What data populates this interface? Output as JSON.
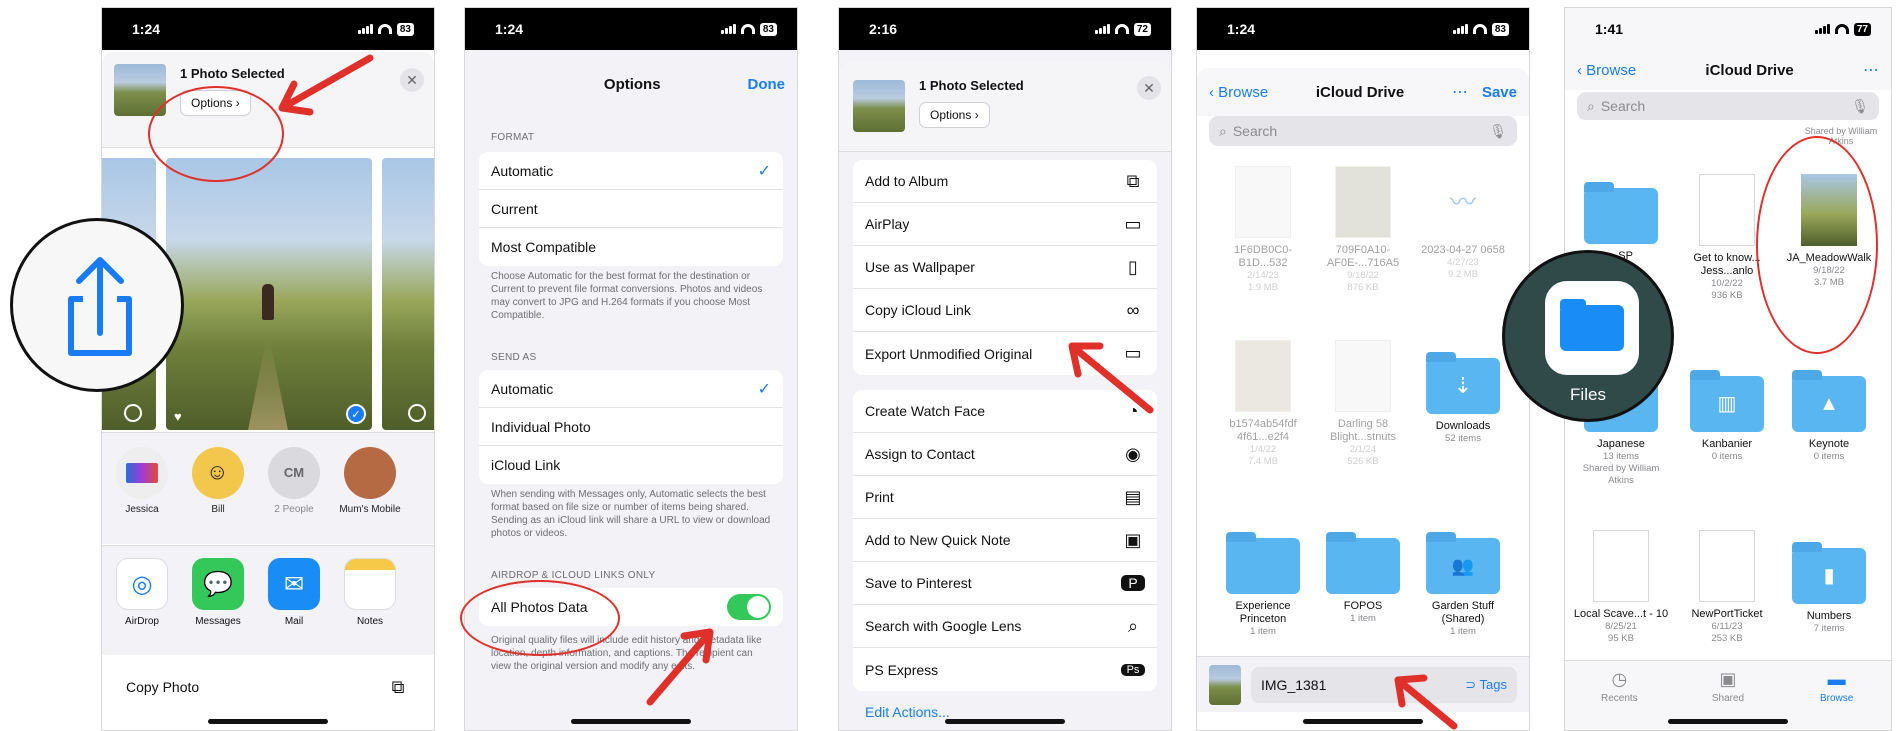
{
  "screens": [
    {
      "time": "1:24",
      "battery": "83",
      "selected_title": "1 Photo Selected",
      "options_label": "Options",
      "contacts": [
        "Jessica",
        "Bill",
        "2 People",
        "Mum's Mobile"
      ],
      "contact_initials": "CM",
      "apps": [
        "AirDrop",
        "Messages",
        "Mail",
        "Notes"
      ],
      "action": "Copy Photo"
    },
    {
      "time": "1:24",
      "battery": "83",
      "title": "Options",
      "done": "Done",
      "format_header": "FORMAT",
      "format_options": [
        "Automatic",
        "Current",
        "Most Compatible"
      ],
      "format_note": "Choose Automatic for the best format for the destination or Current to prevent file format conversions. Photos and videos may convert to JPG and H.264 formats if you choose Most Compatible.",
      "sendas_header": "SEND AS",
      "sendas_options": [
        "Automatic",
        "Individual Photo",
        "iCloud Link"
      ],
      "sendas_note": "When sending with Messages only, Automatic selects the best format based on file size or number of items being shared. Sending as an iCloud link will share a URL to view or download photos or videos.",
      "airdrop_header": "AIRDROP & ICLOUD LINKS ONLY",
      "all_photos_data": "All Photos Data",
      "all_photos_note": "Original quality files will include edit history and metadata like location, depth information, and captions. The recipient can view the original version and modify any edits."
    },
    {
      "time": "2:16",
      "battery": "72",
      "selected_title": "1 Photo Selected",
      "options_label": "Options",
      "group1": [
        {
          "label": "Add to Album",
          "icon": "album-icon"
        },
        {
          "label": "AirPlay",
          "icon": "airplay-icon"
        },
        {
          "label": "Use as Wallpaper",
          "icon": "phone-icon"
        },
        {
          "label": "Copy iCloud Link",
          "icon": "link-icon"
        },
        {
          "label": "Export Unmodified Original",
          "icon": "folder-icon"
        }
      ],
      "group2": [
        {
          "label": "Create Watch Face",
          "icon": "watch-icon"
        },
        {
          "label": "Assign to Contact",
          "icon": "contact-icon"
        },
        {
          "label": "Print",
          "icon": "printer-icon"
        },
        {
          "label": "Add to New Quick Note",
          "icon": "note-icon"
        },
        {
          "label": "Save to Pinterest",
          "icon": "pinterest-icon"
        },
        {
          "label": "Search with Google Lens",
          "icon": "search-icon"
        },
        {
          "label": "PS Express",
          "icon": "ps-icon"
        }
      ],
      "edit_actions": "Edit Actions..."
    },
    {
      "time": "1:24",
      "battery": "83",
      "back": "Browse",
      "title": "iCloud Drive",
      "save": "Save",
      "search_placeholder": "Search",
      "items": [
        {
          "name": "1F6DB0C0-B1D...532",
          "date": "2/14/23",
          "size": "1.9 MB",
          "kind": "doc",
          "faded": true
        },
        {
          "name": "709F0A10-AF0E-...716A5",
          "date": "9/18/22",
          "size": "876 KB",
          "kind": "doc",
          "faded": true
        },
        {
          "name": "2023-04-27 0658",
          "date": "4/27/23",
          "size": "9.2 MB",
          "kind": "audio",
          "faded": true
        },
        {
          "name": "b1574ab54fdf 4f61...e2f4",
          "date": "1/4/22",
          "size": "7.4 MB",
          "kind": "doc",
          "faded": true
        },
        {
          "name": "Darling 58 Blight...stnuts",
          "date": "2/1/24",
          "size": "526 KB",
          "kind": "doc",
          "faded": true
        },
        {
          "name": "Downloads",
          "date": "52 items",
          "size": "",
          "kind": "folder-download",
          "faded": false
        },
        {
          "name": "Experience Princeton",
          "date": "1 item",
          "size": "",
          "kind": "folder",
          "faded": false
        },
        {
          "name": "FOPOS",
          "date": "1 item",
          "size": "",
          "kind": "folder",
          "faded": false
        },
        {
          "name": "Garden Stuff (Shared)",
          "date": "1 item",
          "size": "",
          "kind": "folder-shared",
          "faded": false
        }
      ],
      "filename": "IMG_1381",
      "tags": "Tags"
    },
    {
      "time": "1:41",
      "battery": "77",
      "back": "Browse",
      "title": "iCloud Drive",
      "search_placeholder": "Search",
      "shared_by_top": "Shared by William Atkins",
      "items": [
        {
          "name": "...SP",
          "meta1": "",
          "meta2": "",
          "kind": "folder"
        },
        {
          "name": "Get to know... Jess...anlo",
          "meta1": "10/2/22",
          "meta2": "936 KB",
          "kind": "doc"
        },
        {
          "name": "JA_MeadowWalk",
          "meta1": "9/18/22",
          "meta2": "3.7 MB",
          "kind": "photo"
        },
        {
          "name": "Japanese",
          "meta1": "13 items",
          "meta2": "Shared by William Atkins",
          "kind": "folder"
        },
        {
          "name": "Kanbanier",
          "meta1": "0 items",
          "meta2": "",
          "kind": "folder-kanban"
        },
        {
          "name": "Keynote",
          "meta1": "0 items",
          "meta2": "",
          "kind": "folder-keynote"
        },
        {
          "name": "Local Scave...t - 10",
          "meta1": "8/25/21",
          "meta2": "95 KB",
          "kind": "doc"
        },
        {
          "name": "NewPortTicket",
          "meta1": "6/11/23",
          "meta2": "253 KB",
          "kind": "doc"
        },
        {
          "name": "Numbers",
          "meta1": "7 items",
          "meta2": "",
          "kind": "folder-numbers"
        }
      ],
      "files_callout": "Files",
      "tabs": [
        "Recents",
        "Shared",
        "Browse"
      ]
    }
  ]
}
